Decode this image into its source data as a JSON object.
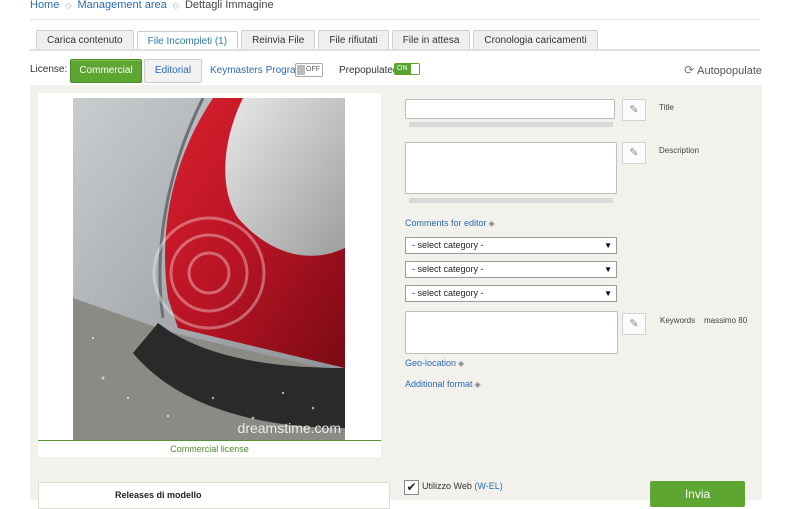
{
  "breadcrumb": {
    "home": "Home",
    "management": "Management area",
    "current": "Dettagli Immagine"
  },
  "tabs": [
    {
      "label": "Carica contenuto"
    },
    {
      "label": "File Incompleti (1)"
    },
    {
      "label": "Reinvia File"
    },
    {
      "label": "File rifiutati"
    },
    {
      "label": "File in attesa"
    },
    {
      "label": "Cronologia caricamenti"
    }
  ],
  "license": {
    "label": "License:",
    "commercial": "Commercial",
    "editorial": "Editorial",
    "keymasters": "Keymasters Program",
    "keymasters_toggle": "OFF",
    "prepopulated": "Prepopulated",
    "prepopulated_toggle": "ON",
    "autopopulate": "Autopopulate"
  },
  "image": {
    "watermark": "dreamstime.com",
    "caption": "Commercial license"
  },
  "form": {
    "title_label": "Title",
    "title_value": "",
    "description_label": "Description",
    "description_value": "",
    "comments_link": "Comments for editor",
    "category_placeholder": "- select category -",
    "keywords_label": "Keywords",
    "keywords_max": "massimo 80",
    "keywords_value": "",
    "geo_link": "Geo-location",
    "additional_link": "Additional format"
  },
  "bottom": {
    "releases_title": "Releases di modello",
    "web_use": "Utilizzo Web",
    "web_use_code": "(W-EL)",
    "web_use_checked": true,
    "submit": "Invia"
  },
  "colors": {
    "accent_green": "#5ea632",
    "link_blue": "#2a6bb5",
    "panel_bg": "#f3f1ec"
  }
}
